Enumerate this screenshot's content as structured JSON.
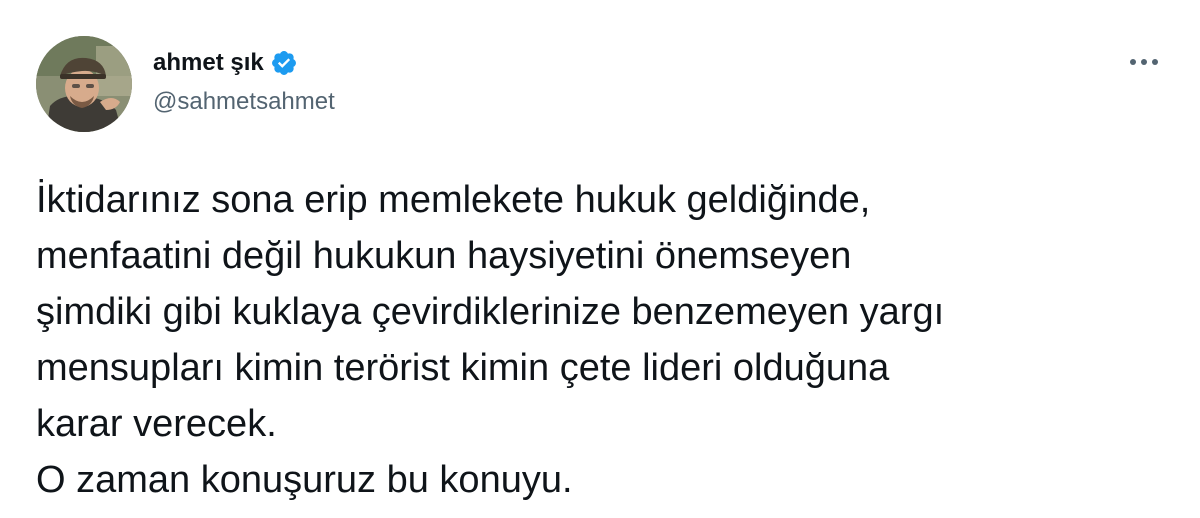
{
  "author": {
    "display_name": "ahmet şık",
    "handle": "@sahmetsahmet",
    "verified_icon": "verified-badge-icon",
    "avatar_icon": "profile-photo"
  },
  "menu": {
    "icon": "more-options-icon"
  },
  "tweet": {
    "lines": [
      "İktidarınız sona erip memlekete hukuk geldiğinde,",
      "menfaatini değil hukukun haysiyetini önemseyen",
      "şimdiki gibi kuklaya çevirdiklerinize benzemeyen yargı",
      "mensupları kimin terörist kimin çete lideri olduğuna",
      "karar verecek.",
      "O zaman konuşuruz bu konuyu."
    ]
  },
  "colors": {
    "text": "#0f1419",
    "secondary": "#536471",
    "verified": "#1d9bf0"
  }
}
